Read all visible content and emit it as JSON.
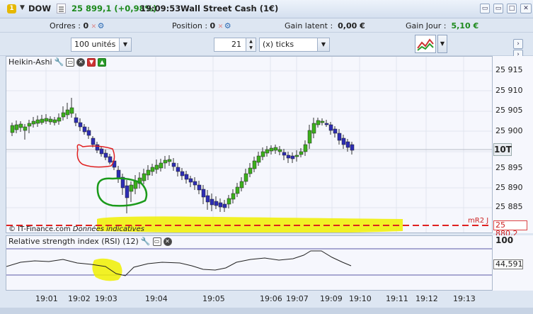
{
  "titlebar": {
    "badge": "1",
    "symbol": "DOW",
    "price_change": "25 899,1 (+0,98%)",
    "time": "19:09:53",
    "instrument": "Wall Street Cash (1€)"
  },
  "ordersbar": {
    "orders_label": "Ordres :",
    "orders_value": "0",
    "position_label": "Position :",
    "position_value": "0",
    "unrealized_label": "Gain latent :",
    "unrealized_value": "0,00 €",
    "daily_gain_label": "Gain Jour :",
    "daily_gain_value": "5,10 €"
  },
  "controls": {
    "quantity_select": "100 unités",
    "ticks_value": "21",
    "ticks_unit_select": "(x) ticks"
  },
  "price_chart": {
    "title": "Heikin-Ashi",
    "y_ticks": [
      "25 915",
      "25 910",
      "25 905",
      "25 900",
      "25 895",
      "25 890",
      "25 885"
    ],
    "current_marker": "10T",
    "mr2_label": "mR2 J",
    "mr2_value": "25 880,2",
    "watermark_brand": "© IT-Finance.com",
    "watermark_note": "Données indicatives"
  },
  "rsi_chart": {
    "title": "Relative strength index (RSI) (12)",
    "y_top": "100",
    "current_value": "44,591"
  },
  "x_ticks": [
    "19:01",
    "19:02",
    "19:03",
    "19:04",
    "19:05",
    "19:06",
    "19:07",
    "19:09",
    "19:10",
    "19:11",
    "19:12",
    "19:13"
  ],
  "colors": {
    "bull": "#3cb01c",
    "bear": "#2d2db4",
    "price_up": "#1d8a1d",
    "mr2_line": "#e02020",
    "highlight": "#f0f000"
  }
}
